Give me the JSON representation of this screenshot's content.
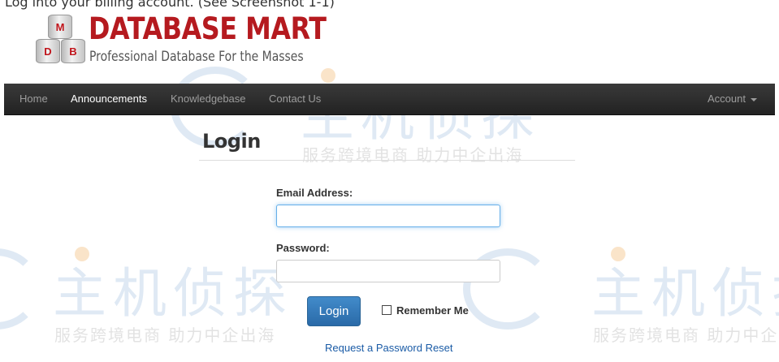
{
  "caption": "Log into your billing account. (See Screenshot 1-1)",
  "logo": {
    "barrels": [
      "M",
      "D",
      "B"
    ],
    "title": "DATABASE MART",
    "tagline": "Professional Database For the Masses"
  },
  "nav": {
    "items": [
      {
        "label": "Home",
        "active": false
      },
      {
        "label": "Announcements",
        "active": true
      },
      {
        "label": "Knowledgebase",
        "active": false
      },
      {
        "label": "Contact Us",
        "active": false
      }
    ],
    "account_label": "Account"
  },
  "login": {
    "title": "Login",
    "email_label": "Email Address:",
    "email_value": "",
    "password_label": "Password:",
    "password_value": "",
    "button_label": "Login",
    "remember_label": "Remember Me",
    "remember_checked": false,
    "reset_link": "Request a Password Reset"
  },
  "watermark": {
    "main": "主机侦探",
    "sub": "服务跨境电商 助力中企出海"
  },
  "colors": {
    "brand_red": "#b51a1f",
    "navbar": "#222222",
    "primary_button": "#428bca",
    "link": "#1a5ba6"
  }
}
